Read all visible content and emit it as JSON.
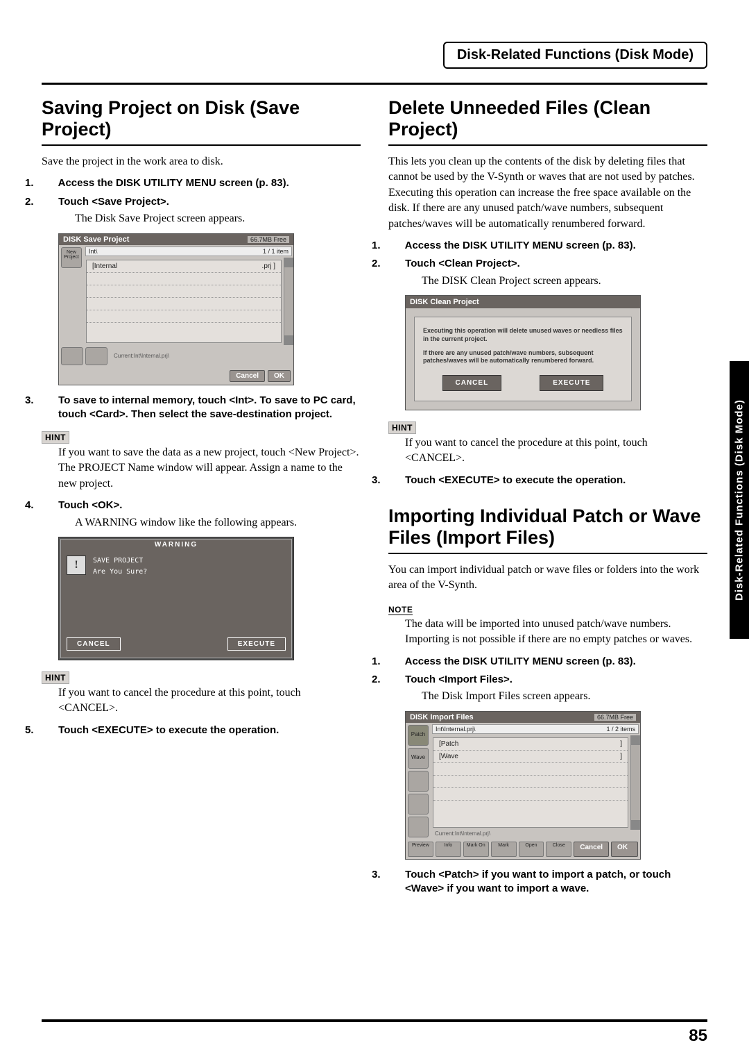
{
  "header": "Disk-Related Functions (Disk Mode)",
  "sidetab": "Disk-Related Functions (Disk Mode)",
  "page_number": "85",
  "left": {
    "h": "Saving Project on Disk (Save Project)",
    "intro": "Save the project in the work area to disk.",
    "s1": "Access the DISK UTILITY MENU screen (p. 83).",
    "s2": "Touch <Save Project>.",
    "s2b": "The Disk Save Project screen appears.",
    "shot1": {
      "title": "DISK Save Project",
      "free": "66.7MB Free",
      "path": "Int\\",
      "items": "1 / 1 item",
      "row_name": "[Internal",
      "row_ext": ".prj ]",
      "current": "Current:Int\\Internal.prj\\",
      "cancel": "Cancel",
      "ok": "OK",
      "new_project": "New Project"
    },
    "s3": "To save to internal memory, touch <Int>. To save to PC card, touch <Card>. Then select the save-destination project.",
    "hint1_label": "HINT",
    "hint1": "If you want to save the data as a new project, touch <New Project>. The PROJECT Name window will appear. Assign a name to the new project.",
    "s4": "Touch <OK>.",
    "s4b": "A WARNING window like the following appears.",
    "warn": {
      "title": "WARNING",
      "l1": "SAVE PROJECT",
      "l2": "Are You Sure?",
      "cancel": "CANCEL",
      "exec": "EXECUTE"
    },
    "hint2_label": "HINT",
    "hint2": "If you want to cancel the procedure at this point, touch <CANCEL>.",
    "s5": "Touch <EXECUTE> to execute the operation."
  },
  "right": {
    "h1": "Delete Unneeded Files (Clean Project)",
    "intro1": "This lets you clean up the contents of the disk by deleting files that cannot be used by the V-Synth or waves that are not used by patches. Executing this operation can increase the free space available on the disk. If there are any unused patch/wave numbers, subsequent patches/waves will be automatically renumbered forward.",
    "s1": "Access the DISK UTILITY MENU screen (p. 83).",
    "s2": "Touch <Clean Project>.",
    "s2b": "The DISK Clean Project screen appears.",
    "clean": {
      "title": "DISK Clean Project",
      "msg1": "Executing this operation will delete unused waves or needless files in the current project.",
      "msg2": "If there are any unused patch/wave numbers, subsequent patches/waves will be automatically renumbered forward.",
      "cancel": "CANCEL",
      "exec": "EXECUTE"
    },
    "hint1_label": "HINT",
    "hint1": "If you want to cancel the procedure at this point, touch <CANCEL>.",
    "s3": "Touch <EXECUTE> to execute the operation.",
    "h2": "Importing Individual Patch or Wave Files (Import Files)",
    "intro2": "You can import individual patch or wave files or folders into the work area of the V-Synth.",
    "note_label": "NOTE",
    "note": "The data will be imported into unused patch/wave numbers. Importing is not possible if there are no empty patches or waves.",
    "s4": "Access the DISK UTILITY MENU screen (p. 83).",
    "s5": "Touch <Import Files>.",
    "s5b": "The Disk Import Files screen appears.",
    "shot2": {
      "title": "DISK Import Files",
      "free": "66.7MB Free",
      "path": "Int\\Internal.prj\\",
      "items": "1 / 2 items",
      "tab_patch": "Patch",
      "tab_wave": "Wave",
      "row1_name": "[Patch",
      "row1_ext": "]",
      "row2_name": "[Wave",
      "row2_ext": "]",
      "current": "Current:Int\\Internal.prj\\",
      "preview": "Preview",
      "info": "Info",
      "markon": "Mark On",
      "mark": "Mark",
      "open": "Open",
      "close": "Close",
      "cancel": "Cancel",
      "ok": "OK"
    },
    "s6": "Touch <Patch> if you want to import a patch, or touch <Wave> if you want to import a wave."
  }
}
